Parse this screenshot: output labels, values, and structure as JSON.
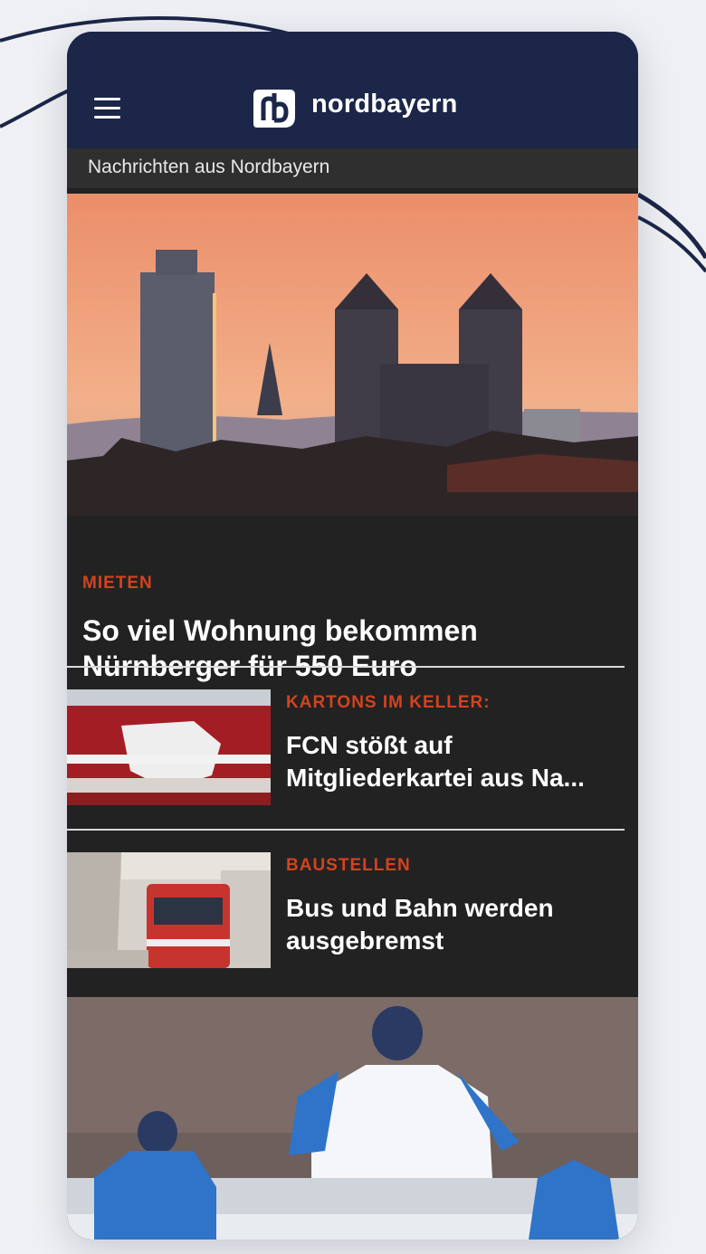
{
  "app": {
    "brand": "nordbayern",
    "tagline": "Nachrichten aus Nordbayern",
    "menu_icon": "hamburger-menu-icon",
    "logo_icon": "nordbayern-nb-logo-icon"
  },
  "lead_article": {
    "kicker": "MIETEN",
    "title": "So viel Wohnung bekommen Nürnberger für 550 Euro"
  },
  "articles": [
    {
      "kicker": "KARTONS IM KELLER:",
      "title_line1": "FCN stößt auf",
      "title_line2": "Mitgliederkartei aus Na..."
    },
    {
      "kicker": "BAUSTELLEN",
      "title_line1": "Bus und Bahn werden",
      "title_line2": "ausgebremst"
    }
  ],
  "colors": {
    "header_bg": "#1c2648",
    "tagline_bg": "#2f2f2f",
    "card_bg": "#222222",
    "kicker": "#d3431f",
    "text": "#ffffff"
  }
}
